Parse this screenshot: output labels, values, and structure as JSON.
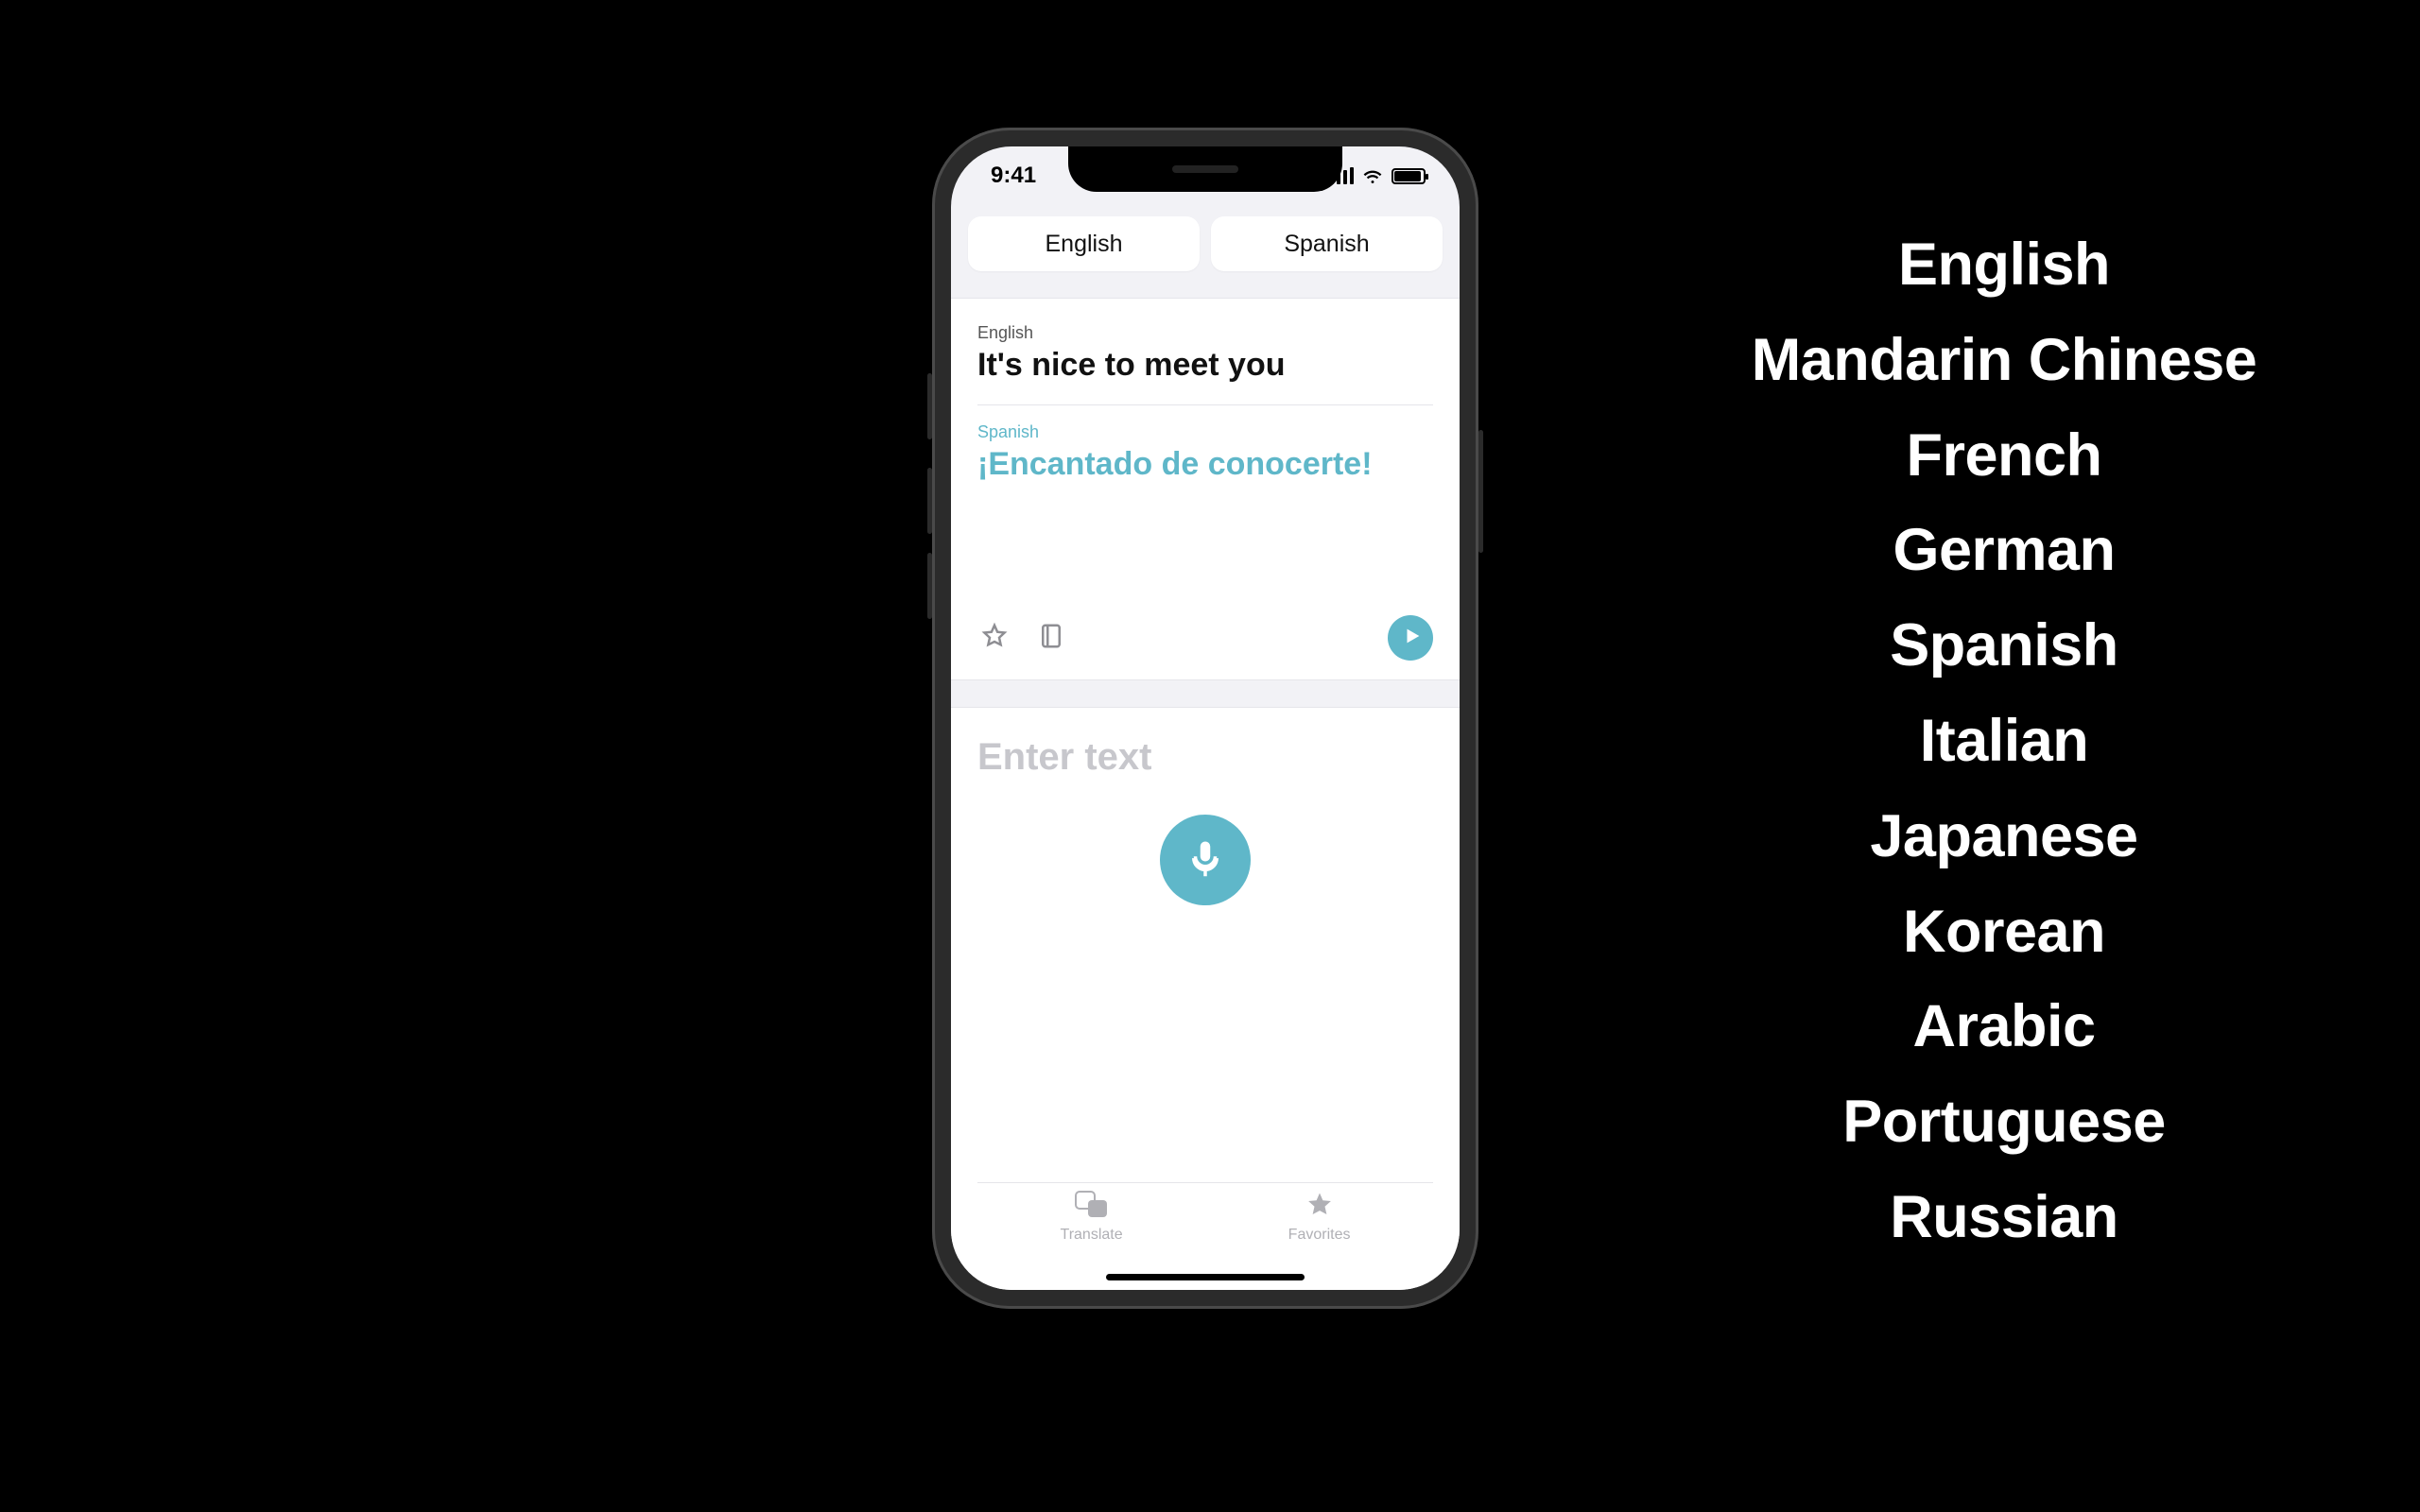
{
  "statusbar": {
    "time": "9:41"
  },
  "language_pills": {
    "source": "English",
    "target": "Spanish"
  },
  "translation": {
    "source_lang": "English",
    "source_text": "It's nice to meet you",
    "target_lang": "Spanish",
    "target_text": "¡Encantado de conocerte!"
  },
  "input": {
    "placeholder": "Enter text"
  },
  "tabs": {
    "translate": "Translate",
    "favorites": "Favorites"
  },
  "supported_languages": [
    "English",
    "Mandarin Chinese",
    "French",
    "German",
    "Spanish",
    "Italian",
    "Japanese",
    "Korean",
    "Arabic",
    "Portuguese",
    "Russian"
  ],
  "colors": {
    "accent": "#5fb7c9"
  }
}
